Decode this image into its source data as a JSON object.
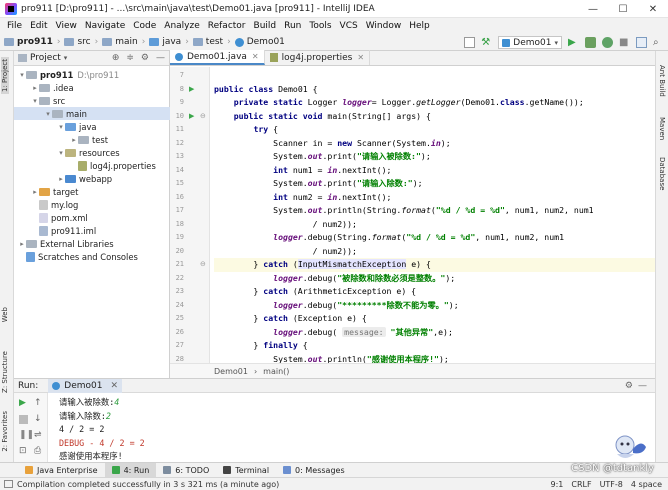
{
  "title_bar": {
    "text": "pro911 [D:\\pro911] - ...\\src\\main\\java\\test\\Demo01.java [pro911] - IntelliJ IDEA",
    "controls": [
      "—",
      "☐",
      "✕"
    ]
  },
  "menu": [
    "File",
    "Edit",
    "View",
    "Navigate",
    "Code",
    "Analyze",
    "Refactor",
    "Build",
    "Run",
    "Tools",
    "VCS",
    "Window",
    "Help"
  ],
  "breadcrumbs": [
    "pro911",
    "src",
    "main",
    "java",
    "test",
    "Demo01"
  ],
  "run_config": "Demo01",
  "left_stripe": {
    "project": "1: Project",
    "web": "Web",
    "structure": "Z: Structure",
    "favorites": "2: Favorites"
  },
  "right_stripe": {
    "ant": "Ant Build",
    "maven": "Maven",
    "database": "Database"
  },
  "project_panel": {
    "header": "Project",
    "tree": [
      {
        "label": "pro911",
        "extra": "D:\\pro911",
        "level": 0,
        "icon": "folder",
        "open": true
      },
      {
        "label": ".idea",
        "level": 1,
        "icon": "folder",
        "open": false
      },
      {
        "label": "src",
        "level": 1,
        "icon": "folder",
        "open": true
      },
      {
        "label": "main",
        "level": 2,
        "icon": "folder",
        "open": true,
        "selected": true
      },
      {
        "label": "java",
        "level": 3,
        "icon": "folder-src",
        "open": true
      },
      {
        "label": "test",
        "level": 4,
        "icon": "package",
        "open": false
      },
      {
        "label": "resources",
        "level": 3,
        "icon": "folder-res",
        "open": true
      },
      {
        "label": "log4j.properties",
        "level": 4,
        "icon": "properties"
      },
      {
        "label": "webapp",
        "level": 3,
        "icon": "folder-web",
        "open": false
      },
      {
        "label": "target",
        "level": 1,
        "icon": "folder-orange",
        "open": false
      },
      {
        "label": "my.log",
        "level": 1,
        "icon": "file"
      },
      {
        "label": "pom.xml",
        "level": 1,
        "icon": "maven"
      },
      {
        "label": "pro911.iml",
        "level": 1,
        "icon": "iml"
      },
      {
        "label": "External Libraries",
        "level": 0,
        "icon": "libraries",
        "open": false
      },
      {
        "label": "Scratches and Consoles",
        "level": 0,
        "icon": "scratches"
      }
    ]
  },
  "editor": {
    "tabs": [
      {
        "label": "Demo01.java",
        "active": true
      },
      {
        "label": "log4j.properties",
        "active": false
      }
    ],
    "line_numbers": [
      "7",
      "8",
      "9",
      "10",
      "11",
      "12",
      "13",
      "14",
      "15",
      "16",
      "17",
      "18",
      "19",
      "20",
      "21",
      "22",
      "23",
      "24",
      "25",
      "26",
      "27",
      "28"
    ],
    "code": [
      "",
      "public class Demo01 {",
      "    private static Logger logger= Logger.getLogger(Demo01.class.getName());",
      "    public static void main(String[] args) {",
      "        try {",
      "            Scanner in = new Scanner(System.in);",
      "            System.out.print(\"请输入被除数:\");",
      "            int num1 = in.nextInt();",
      "            System.out.print(\"请输入除数:\");",
      "            int num2 = in.nextInt();",
      "            System.out.println(String.format(\"%d / %d = %d\", num1, num2, num1",
      "                    / num2));",
      "            logger.debug(String.format(\"%d / %d = %d\", num1, num2, num1",
      "                    / num2));",
      "        } catch (InputMismatchException e) {",
      "            logger.debug(\"被除数和除数必须是整数。\");",
      "        } catch (ArithmeticException e) {",
      "            logger.debug(\"*********除数不能为零。\");",
      "        } catch (Exception e) {",
      "            logger.debug( message: \"其他异常\",e);",
      "        } finally {",
      "            System.out.println(\"感谢使用本程序!\");"
    ],
    "bottom_breadcrumb": [
      "Demo01",
      "main()"
    ]
  },
  "run_panel": {
    "label": "Run:",
    "tab": "Demo01",
    "console": [
      {
        "text": "请输入被除数:4",
        "input": "4"
      },
      {
        "text": "请输入除数:2",
        "input": "2"
      },
      {
        "text": "4 / 2 = 2"
      },
      {
        "text": "DEBUG - 4 / 2 = 2",
        "color": "#c0392b"
      },
      {
        "text": "感谢使用本程序!"
      }
    ]
  },
  "bottom_tabs": [
    "Java Enterprise",
    "4: Run",
    "6: TODO",
    "Terminal",
    "0: Messages"
  ],
  "status": {
    "message": "Compilation completed successfully in 3 s 321 ms (a minute ago)",
    "position": "9:1",
    "line_sep": "CRLF",
    "encoding": "UTF-8",
    "indent": "4 space"
  },
  "watermark": "CSDN @tdtankly"
}
